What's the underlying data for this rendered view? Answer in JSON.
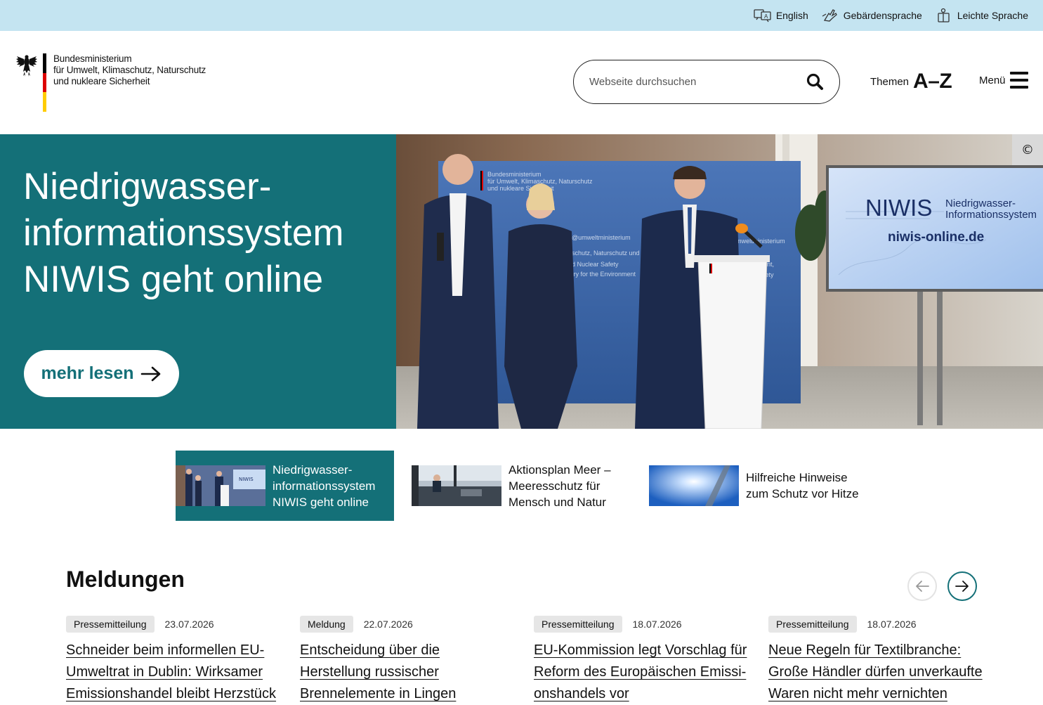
{
  "utility_bar": {
    "links": [
      {
        "label": "English",
        "icon": "language-icon"
      },
      {
        "label": "Gebärdensprache",
        "icon": "sign-language-icon"
      },
      {
        "label": "Leichte Sprache",
        "icon": "easy-language-icon"
      }
    ]
  },
  "header": {
    "ministry_lines": [
      "Bundesministerium",
      "für Umwelt, Klimaschutz, Naturschutz",
      "und nukleare Sicherheit"
    ],
    "search_placeholder": "Webseite durchsuchen",
    "themen_label": "Themen",
    "themen_az": "A–Z",
    "menu_label": "Menü"
  },
  "hero": {
    "title_lines": [
      "Niedrigwasser-",
      "informationssystem",
      "NIWIS geht online"
    ],
    "button_label": "mehr lesen",
    "copyright_symbol": "©",
    "image_texts": {
      "niwis": "NIWIS",
      "niwis_sub_1": "Niedrigwasser-",
      "niwis_sub_2": "Informationssystem",
      "niwis_url": "niwis-online.de"
    },
    "colors": {
      "panel": "#147078"
    }
  },
  "thumbnails": [
    {
      "lines": [
        "Niedrigwasser-",
        "informationssystem",
        "NIWIS geht online"
      ],
      "active": true
    },
    {
      "lines": [
        "Aktionsplan Meer –",
        "Meeresschutz für",
        "Mensch und Natur"
      ],
      "active": false
    },
    {
      "lines": [
        "Hilfreiche Hinweise",
        "zum Schutz vor Hitze"
      ],
      "active": false
    }
  ],
  "news": {
    "title": "Meldungen",
    "cards": [
      {
        "tag": "Pressemitteilung",
        "date": "23.07.2026",
        "headline": "Schneider beim informellen EU-Umweltrat in Dublin: Wirksamer Emissionshandel bleibt Herzstück"
      },
      {
        "tag": "Meldung",
        "date": "22.07.2026",
        "headline": "Entscheidung über die Herstellung russischer Brennelemente in Lingen"
      },
      {
        "tag": "Pressemitteilung",
        "date": "18.07.2026",
        "headline": "EU-Kommission legt Vorschlag für Reform des Europäischen Emissi-onshandels vor"
      },
      {
        "tag": "Pressemitteilung",
        "date": "18.07.2026",
        "headline": "Neue Regeln für Textilbranche: Große Händler dürfen unverkaufte Waren nicht mehr vernichten"
      }
    ]
  }
}
